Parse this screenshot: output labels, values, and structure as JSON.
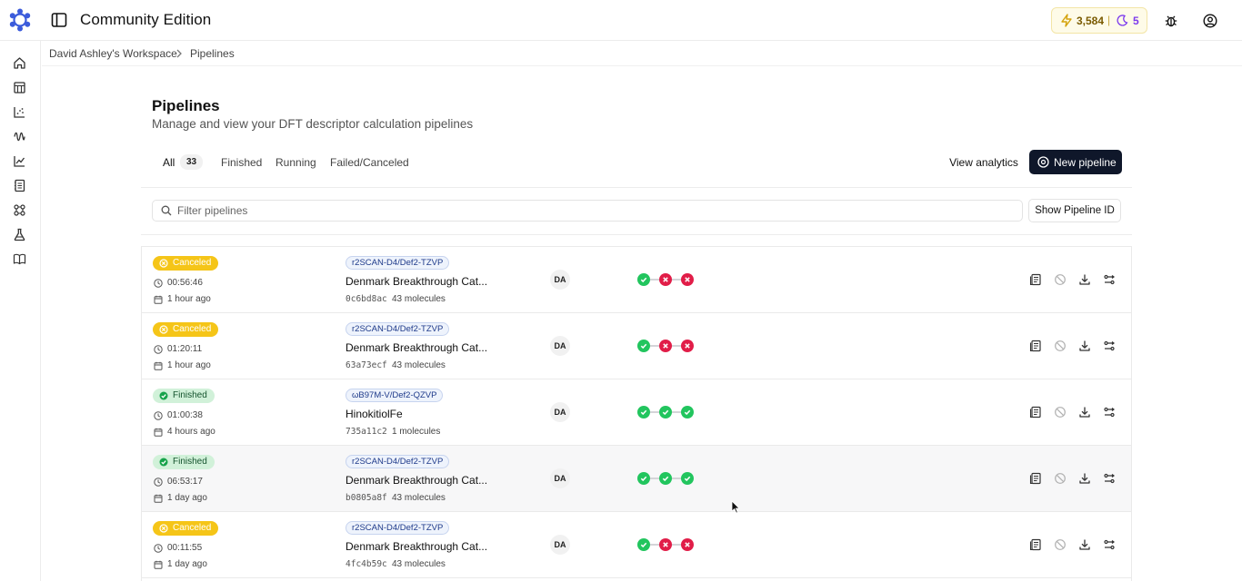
{
  "app": {
    "title": "Community Edition",
    "credits": "3,584",
    "credits_separator": "|",
    "secondary_count": "5",
    "icons": [
      "logo-icon",
      "sidebar-toggle-icon",
      "bolt-icon",
      "moon-icon",
      "bug-icon",
      "user-icon"
    ]
  },
  "sidebar": {
    "items": [
      "home-icon",
      "table-icon",
      "chart-scatter-icon",
      "waveform-icon",
      "line-chart-icon",
      "notebook-icon",
      "molecule-icon",
      "flask-icon",
      "book-icon"
    ]
  },
  "breadcrumb": {
    "workspace": "David Ashley's Workspace",
    "current": "Pipelines"
  },
  "header": {
    "title": "Pipelines",
    "subtitle": "Manage and view your DFT descriptor calculation pipelines"
  },
  "tabs": {
    "all": "All",
    "all_count": "33",
    "finished": "Finished",
    "running": "Running",
    "failed": "Failed/Canceled"
  },
  "actions": {
    "view_analytics": "View analytics",
    "new_pipeline": "New pipeline",
    "show_id": "Show Pipeline ID"
  },
  "filter": {
    "placeholder": "Filter pipelines"
  },
  "rows": [
    {
      "status": "Canceled",
      "duration": "00:56:46",
      "ago": "1 hour ago",
      "method": "r2SCAN-D4/Def2-TZVP",
      "name": "Denmark Breakthrough Cat...",
      "id": "0c6bd8ac",
      "molecules": "43 molecules",
      "owner": "DA",
      "steps": [
        "ok",
        "bad",
        "bad"
      ]
    },
    {
      "status": "Canceled",
      "duration": "01:20:11",
      "ago": "1 hour ago",
      "method": "r2SCAN-D4/Def2-TZVP",
      "name": "Denmark Breakthrough Cat...",
      "id": "63a73ecf",
      "molecules": "43 molecules",
      "owner": "DA",
      "steps": [
        "ok",
        "bad",
        "bad"
      ]
    },
    {
      "status": "Finished",
      "duration": "01:00:38",
      "ago": "4 hours ago",
      "method": "ωB97M-V/Def2-QZVP",
      "name": "HinokitiolFe",
      "id": "735a11c2",
      "molecules": "1 molecules",
      "owner": "DA",
      "steps": [
        "ok",
        "ok",
        "ok"
      ]
    },
    {
      "status": "Finished",
      "duration": "06:53:17",
      "ago": "1 day ago",
      "method": "r2SCAN-D4/Def2-TZVP",
      "name": "Denmark Breakthrough Cat...",
      "id": "b0805a8f",
      "molecules": "43 molecules",
      "owner": "DA",
      "steps": [
        "ok",
        "ok",
        "ok"
      ]
    },
    {
      "status": "Canceled",
      "duration": "00:11:55",
      "ago": "1 day ago",
      "method": "r2SCAN-D4/Def2-TZVP",
      "name": "Denmark Breakthrough Cat...",
      "id": "4fc4b59c",
      "molecules": "43 molecules",
      "owner": "DA",
      "steps": [
        "ok",
        "bad",
        "bad"
      ]
    }
  ],
  "colors": {
    "primary": "#0f172a",
    "canceled": "#f5c518",
    "finished_bg": "#d1f1d9",
    "step_ok": "#22c55e",
    "step_bad": "#e11d48"
  }
}
